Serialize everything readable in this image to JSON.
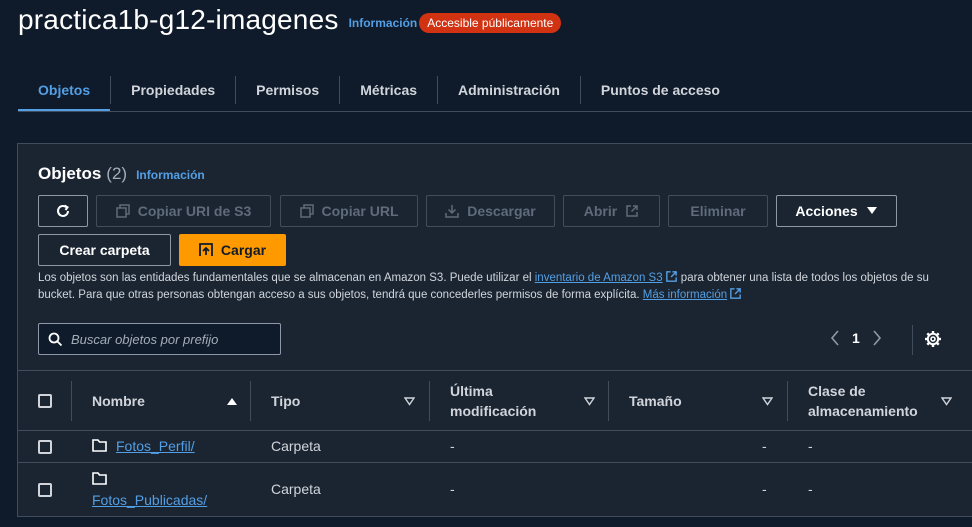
{
  "header": {
    "bucket_name": "practica1b-g12-imagenes",
    "info_label": "Información",
    "public_badge": "Accesible públicamente"
  },
  "tabs": [
    {
      "label": "Objetos",
      "active": true
    },
    {
      "label": "Propiedades"
    },
    {
      "label": "Permisos"
    },
    {
      "label": "Métricas"
    },
    {
      "label": "Administración"
    },
    {
      "label": "Puntos de acceso"
    }
  ],
  "objects_panel": {
    "title": "Objetos",
    "count": "(2)",
    "info_label": "Información",
    "toolbar": {
      "copy_uri": "Copiar URI de S3",
      "copy_url": "Copiar URL",
      "download": "Descargar",
      "open": "Abrir",
      "delete": "Eliminar",
      "actions": "Acciones",
      "create_folder": "Crear carpeta",
      "upload": "Cargar"
    },
    "description": {
      "part1": "Los objetos son las entidades fundamentales que se almacenan en Amazon S3. Puede utilizar el ",
      "link1": "inventario de Amazon S3",
      "part2": " para obtener una lista de todos los objetos de su bucket. Para que otras personas obtengan acceso a sus objetos, tendrá que concederles permisos de forma explícita. ",
      "link2": "Más información"
    },
    "search_placeholder": "Buscar objetos por prefijo",
    "page_number": "1"
  },
  "table": {
    "headers": {
      "name": "Nombre",
      "type": "Tipo",
      "modified_line1": "Última",
      "modified_line2": "modificación",
      "size": "Tamaño",
      "storage_line1": "Clase de",
      "storage_line2": "almacenamiento"
    },
    "rows": [
      {
        "name": "Fotos_Perfil/",
        "type": "Carpeta",
        "modified": "-",
        "size": "-",
        "storage": "-"
      },
      {
        "name": "Fotos_Publicadas/",
        "type": "Carpeta",
        "modified": "-",
        "size": "-",
        "storage": "-"
      }
    ]
  },
  "colors": {
    "background": "#0f1b2a",
    "panel": "#1b2532",
    "accent": "#539fe5",
    "primary_button": "#ff9900",
    "public_badge": "#d13212"
  }
}
